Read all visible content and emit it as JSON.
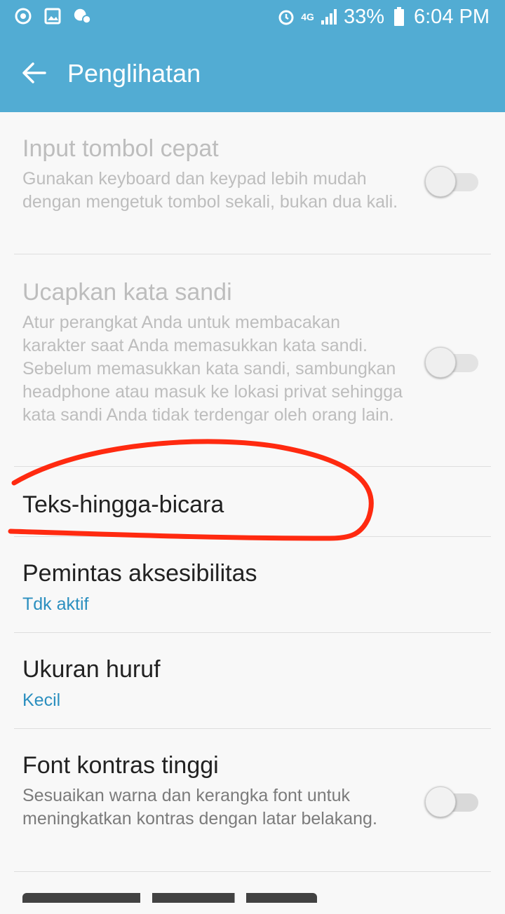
{
  "status_bar": {
    "battery_percent": "33%",
    "time": "6:04 PM",
    "network": "4G",
    "left_icons": [
      "sync-icon",
      "image-icon",
      "voicemail-icon"
    ],
    "right_icons": [
      "alarm-icon",
      "network-4g-icon",
      "signal-icon",
      "battery-icon"
    ]
  },
  "app_bar": {
    "title": "Penglihatan",
    "back_icon": "arrow-left-icon"
  },
  "settings": [
    {
      "title": "Input tombol cepat",
      "subtitle": "Gunakan keyboard dan keypad lebih mudah dengan mengetuk tombol sekali, bukan dua kali.",
      "enabled": false,
      "toggle": "off"
    },
    {
      "title": "Ucapkan kata sandi",
      "subtitle": "Atur perangkat Anda untuk membacakan karakter saat Anda memasukkan kata sandi. Sebelum memasukkan kata sandi, sambungkan headphone atau masuk ke lokasi privat sehingga kata sandi Anda tidak terdengar oleh orang lain.",
      "enabled": false,
      "toggle": "off"
    },
    {
      "title": "Teks-hingga-bicara",
      "annotated": true
    },
    {
      "title": "Pemintas aksesibilitas",
      "value": "Tdk aktif"
    },
    {
      "title": "Ukuran huruf",
      "value": "Kecil"
    },
    {
      "title": "Font kontras tinggi",
      "subtitle": "Sesuaikan warna dan kerangka font untuk meningkatkan kontras dengan latar belakang.",
      "toggle": "off"
    }
  ],
  "colors": {
    "accent": "#52acd3",
    "value_text": "#2b8fbf",
    "annotation": "#ff2a10"
  }
}
